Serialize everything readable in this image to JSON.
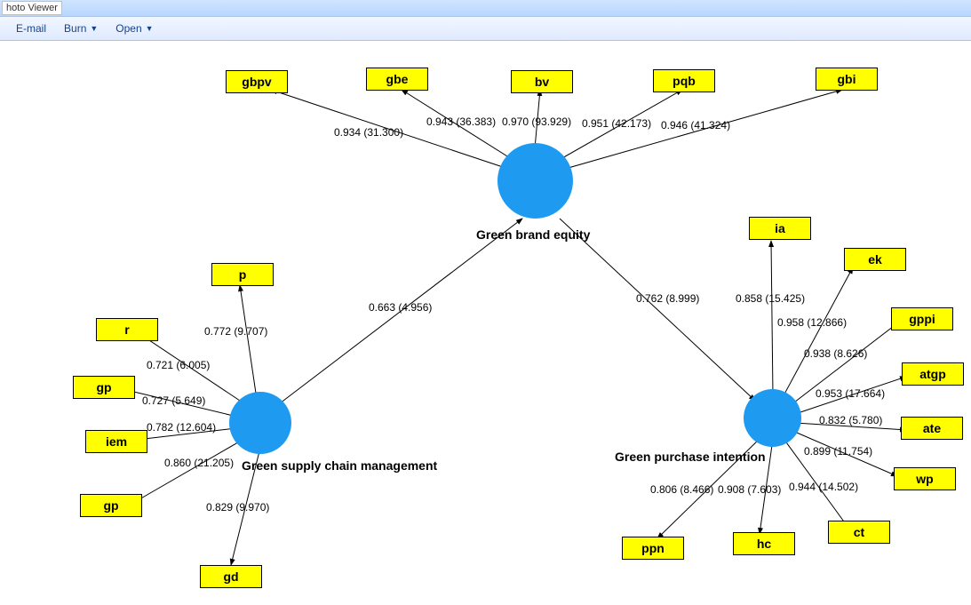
{
  "window": {
    "app_title": "hoto Viewer"
  },
  "toolbar": {
    "email": "E-mail",
    "burn": "Burn",
    "open": "Open"
  },
  "constructs": {
    "gbe": "Green brand equity",
    "gsc": "Green supply chain management",
    "gpi": "Green purchase intention"
  },
  "indicators": {
    "gbpv": "gbpv",
    "gbe": "gbe",
    "bv": "bv",
    "pqb": "pqb",
    "gbi": "gbi",
    "p": "p",
    "r": "r",
    "gp_a": "gp",
    "iem": "iem",
    "gp_b": "gp",
    "gd": "gd",
    "ia": "ia",
    "ek": "ek",
    "gppi": "gppi",
    "atgp": "atgp",
    "ate": "ate",
    "wp": "wp",
    "ct": "ct",
    "hc": "hc",
    "ppn": "ppn"
  },
  "paths": {
    "gsc_gbe": "0.663 (4.956)",
    "gbe_gpi": "0.762 (8.999)"
  },
  "loadings": {
    "gbe_gbpv": "0.934 (31.300)",
    "gbe_gbe": "0.943 (36.383)",
    "gbe_bv": "0.970 (93.929)",
    "gbe_pqb": "0.951 (42.173)",
    "gbe_gbi": "0.946 (41.324)",
    "gsc_p": "0.772 (9.707)",
    "gsc_r": "0.721 (6.005)",
    "gsc_gp_a": "0.727 (5.649)",
    "gsc_iem": "0.782 (12.604)",
    "gsc_gp_b": "0.860 (21.205)",
    "gsc_gd": "0.829 (9.970)",
    "gpi_ia": "0.858 (15.425)",
    "gpi_ek": "0.958 (12.866)",
    "gpi_gppi": "0.938 (8.626)",
    "gpi_atgp": "0.953 (17.664)",
    "gpi_ate": "0.832 (5.780)",
    "gpi_wp": "0.899 (11.754)",
    "gpi_ct": "0.944 (14.502)",
    "gpi_hc": "0.908 (7.603)",
    "gpi_ppn": "0.806 (8.466)"
  },
  "chart_data": {
    "type": "diagram",
    "latent_variables": [
      "Green brand equity",
      "Green supply chain management",
      "Green purchase intention"
    ],
    "structural_paths": [
      {
        "from": "Green supply chain management",
        "to": "Green brand equity",
        "coef": 0.663,
        "t": 4.956
      },
      {
        "from": "Green brand equity",
        "to": "Green purchase intention",
        "coef": 0.762,
        "t": 8.999
      }
    ],
    "measurement": [
      {
        "lv": "Green brand equity",
        "indicator": "gbpv",
        "loading": 0.934,
        "t": 31.3
      },
      {
        "lv": "Green brand equity",
        "indicator": "gbe",
        "loading": 0.943,
        "t": 36.383
      },
      {
        "lv": "Green brand equity",
        "indicator": "bv",
        "loading": 0.97,
        "t": 93.929
      },
      {
        "lv": "Green brand equity",
        "indicator": "pqb",
        "loading": 0.951,
        "t": 42.173
      },
      {
        "lv": "Green brand equity",
        "indicator": "gbi",
        "loading": 0.946,
        "t": 41.324
      },
      {
        "lv": "Green supply chain management",
        "indicator": "p",
        "loading": 0.772,
        "t": 9.707
      },
      {
        "lv": "Green supply chain management",
        "indicator": "r",
        "loading": 0.721,
        "t": 6.005
      },
      {
        "lv": "Green supply chain management",
        "indicator": "gp",
        "loading": 0.727,
        "t": 5.649
      },
      {
        "lv": "Green supply chain management",
        "indicator": "iem",
        "loading": 0.782,
        "t": 12.604
      },
      {
        "lv": "Green supply chain management",
        "indicator": "gp",
        "loading": 0.86,
        "t": 21.205
      },
      {
        "lv": "Green supply chain management",
        "indicator": "gd",
        "loading": 0.829,
        "t": 9.97
      },
      {
        "lv": "Green purchase intention",
        "indicator": "ia",
        "loading": 0.858,
        "t": 15.425
      },
      {
        "lv": "Green purchase intention",
        "indicator": "ek",
        "loading": 0.958,
        "t": 12.866
      },
      {
        "lv": "Green purchase intention",
        "indicator": "gppi",
        "loading": 0.938,
        "t": 8.626
      },
      {
        "lv": "Green purchase intention",
        "indicator": "atgp",
        "loading": 0.953,
        "t": 17.664
      },
      {
        "lv": "Green purchase intention",
        "indicator": "ate",
        "loading": 0.832,
        "t": 5.78
      },
      {
        "lv": "Green purchase intention",
        "indicator": "wp",
        "loading": 0.899,
        "t": 11.754
      },
      {
        "lv": "Green purchase intention",
        "indicator": "ct",
        "loading": 0.944,
        "t": 14.502
      },
      {
        "lv": "Green purchase intention",
        "indicator": "hc",
        "loading": 0.908,
        "t": 7.603
      },
      {
        "lv": "Green purchase intention",
        "indicator": "ppn",
        "loading": 0.806,
        "t": 8.466
      }
    ]
  }
}
